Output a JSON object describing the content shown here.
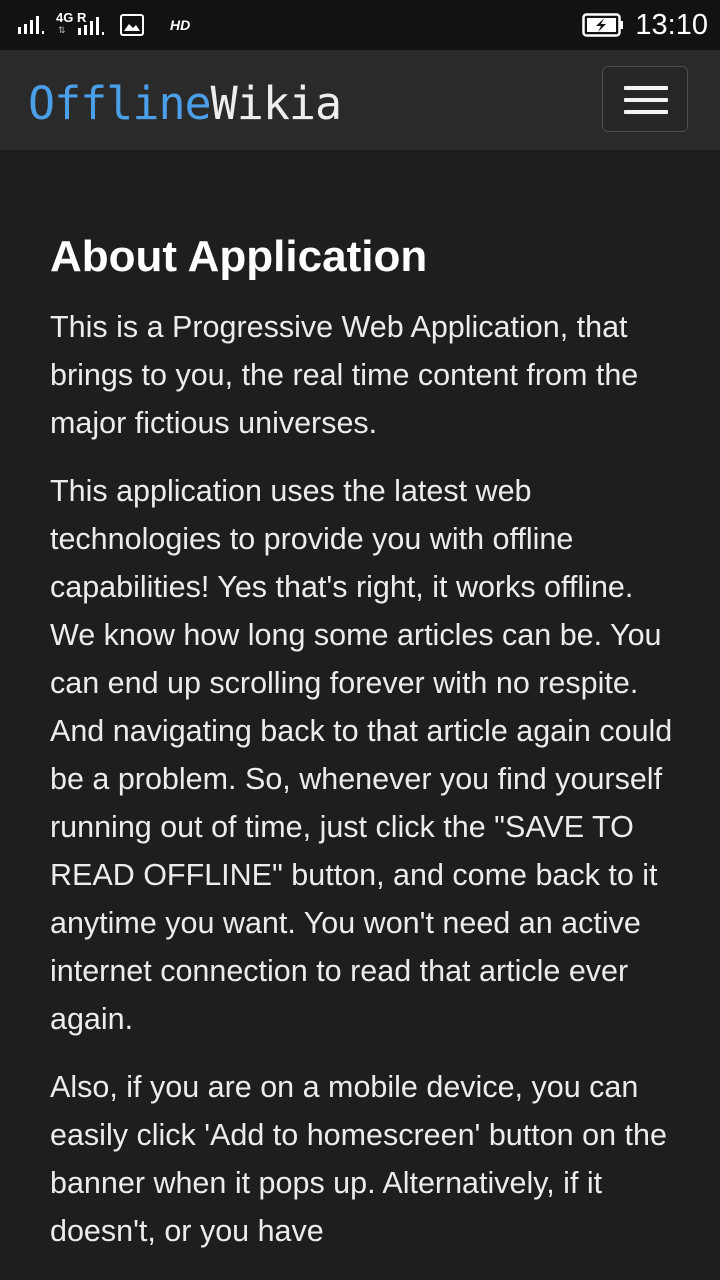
{
  "status_bar": {
    "network_label": "4G R",
    "hd_label": "HD",
    "time": "13:10",
    "icons": [
      "signal-icon",
      "signal-icon",
      "image-icon",
      "battery-charging-icon"
    ]
  },
  "navbar": {
    "brand_part1": "Offline",
    "brand_part2": "Wikia",
    "brand_colors": {
      "offline": "#4a9fe8",
      "wikia": "#eeeeee"
    },
    "menu_icon": "hamburger-menu-icon"
  },
  "main": {
    "title": "About Application",
    "paragraphs": [
      "This is a Progressive Web Application, that brings to you, the real time content from the major fictious universes.",
      "This application uses the latest web technologies to provide you with offline capabilities! Yes that's right, it works offline. We know how long some articles can be. You can end up scrolling forever with no respite. And navigating back to that article again could be a problem. So, whenever you find yourself running out of time, just click the \"SAVE TO READ OFFLINE\" button, and come back to it anytime you want. You won't need an active internet connection to read that article ever again.",
      "Also, if you are on a mobile device, you can easily click 'Add to homescreen' button on the banner when it pops up. Alternatively, if it doesn't, or you have"
    ]
  },
  "colors": {
    "background": "#1e1e1e",
    "navbar": "#2a2a2a",
    "status_bar": "#121212",
    "text": "#ececec"
  }
}
